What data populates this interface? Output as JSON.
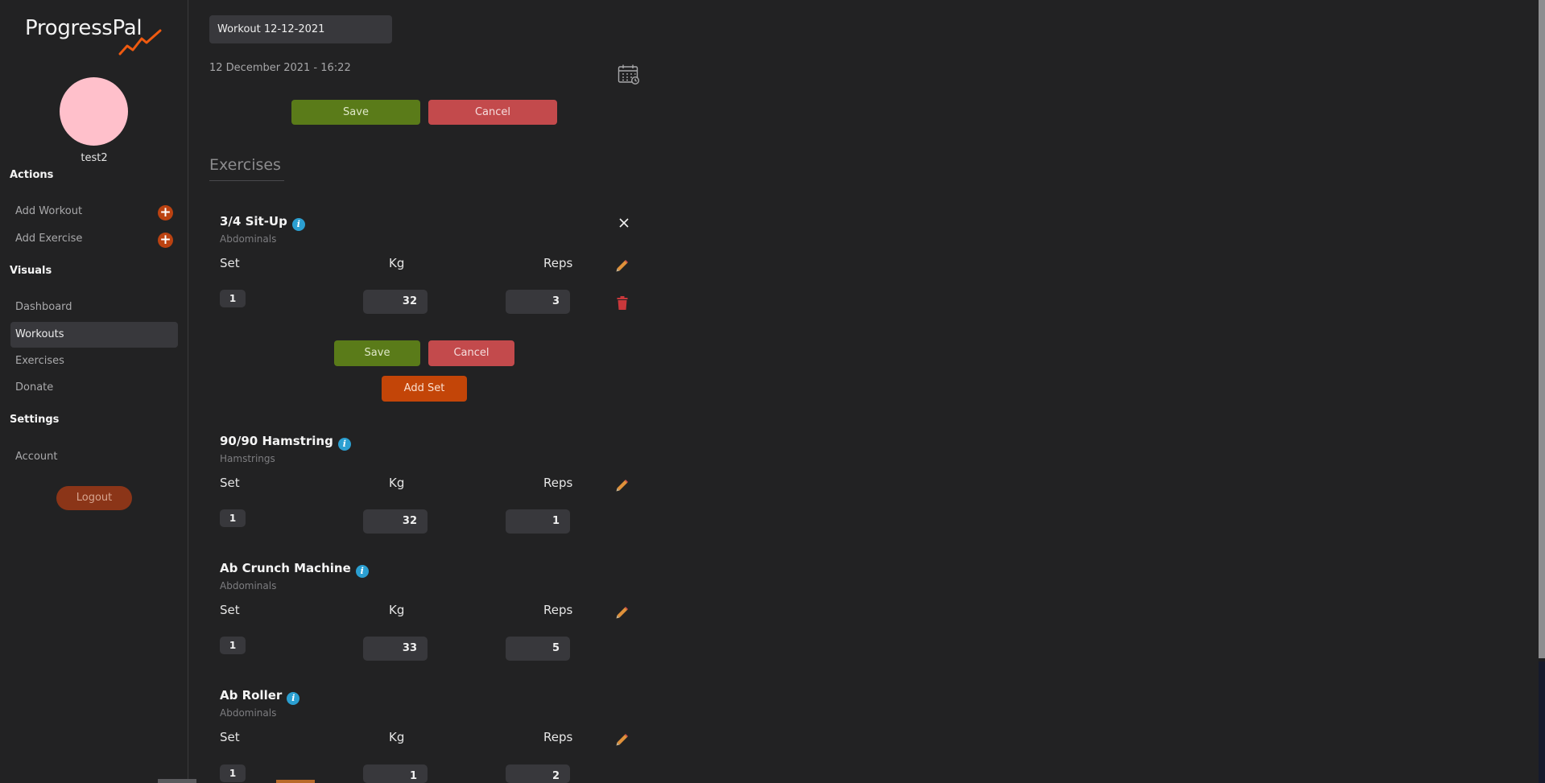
{
  "app": {
    "logo_text": "ProgressPal",
    "accent": "#ef5a10"
  },
  "sidebar": {
    "username": "test2",
    "sections": {
      "actions": "Actions",
      "visuals": "Visuals",
      "settings": "Settings"
    },
    "items": {
      "add_workout": "Add Workout",
      "add_exercise": "Add Exercise",
      "dashboard": "Dashboard",
      "workouts": "Workouts",
      "exercises": "Exercises",
      "donate": "Donate",
      "account": "Account"
    },
    "plus_glyph": "+",
    "active_item": "Workouts",
    "logout_label": "Logout"
  },
  "workout": {
    "title_value": "Workout 12-12-2021",
    "datetime": "12 December 2021 - 16:22",
    "save_label": "Save",
    "cancel_label": "Cancel",
    "exercises_heading": "Exercises"
  },
  "columns": {
    "set": "Set",
    "kg": "Kg",
    "reps": "Reps"
  },
  "exercises": [
    {
      "name": "3/4 Sit-Up",
      "muscle": "Abdominals",
      "editing": true,
      "sets": [
        {
          "set": "1",
          "kg": "32",
          "reps": "3"
        }
      ],
      "save_label": "Save",
      "cancel_label": "Cancel",
      "add_set_label": "Add Set"
    },
    {
      "name": "90/90 Hamstring",
      "muscle": "Hamstrings",
      "sets": [
        {
          "set": "1",
          "kg": "32",
          "reps": "1"
        }
      ]
    },
    {
      "name": "Ab Crunch Machine",
      "muscle": "Abdominals",
      "sets": [
        {
          "set": "1",
          "kg": "33",
          "reps": "5"
        }
      ]
    },
    {
      "name": "Ab Roller",
      "muscle": "Abdominals",
      "sets": [
        {
          "set": "1",
          "kg": "1",
          "reps": "2"
        }
      ]
    }
  ],
  "info_glyph": "i",
  "icons": {
    "info": "info-icon",
    "edit": "pencil-icon",
    "delete": "trash-icon",
    "close": "close-icon",
    "calendar": "calendar-icon"
  },
  "colors": {
    "save": "#5a7b19",
    "cancel": "#c34a4c",
    "add_set": "#c34508",
    "logout": "#8b3518",
    "avatar": "#ffc0cb",
    "info": "#2b9fd1",
    "trash": "#c9383b",
    "pencil": "#e0913a"
  }
}
